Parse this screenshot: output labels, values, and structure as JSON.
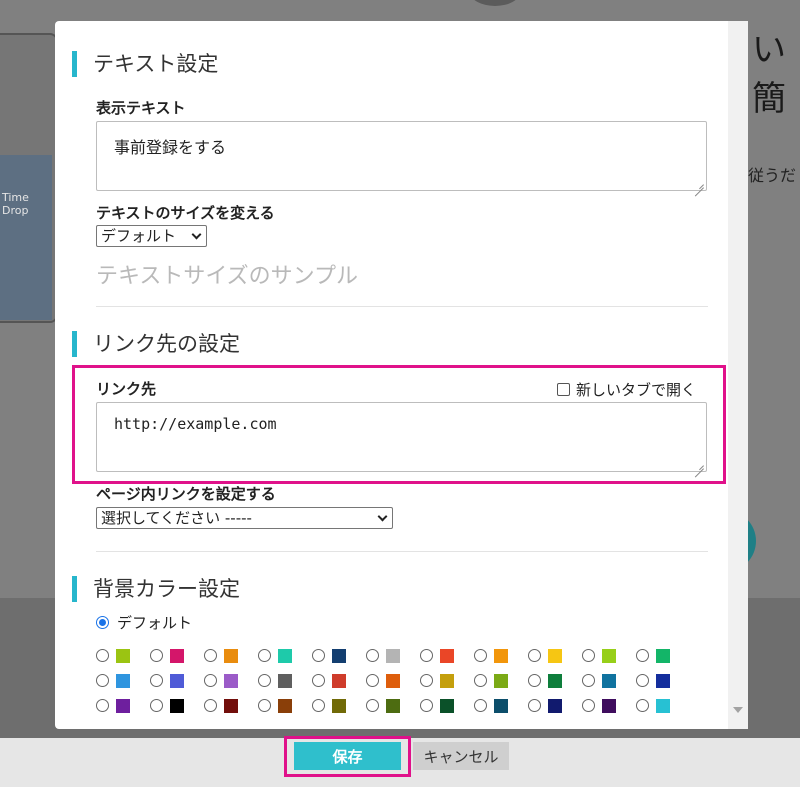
{
  "background": {
    "heading_fragment": "い簡",
    "text_fragment": "従うだ",
    "device_title": "Time Drop"
  },
  "modal": {
    "text_section": {
      "title": "テキスト設定",
      "display_text_label": "表示テキスト",
      "display_text_value": "事前登録をする",
      "size_label": "テキストのサイズを変える",
      "size_selected": "デフォルト",
      "size_sample": "テキストサイズのサンプル"
    },
    "link_section": {
      "title": "リンク先の設定",
      "link_label": "リンク先",
      "new_tab_label": "新しいタブで開く",
      "new_tab_checked": false,
      "link_value": "http://example.com",
      "anchor_label": "ページ内リンクを設定する",
      "anchor_selected": "選択してください -----"
    },
    "color_section": {
      "title": "背景カラー設定",
      "default_label": "デフォルト",
      "default_checked": true,
      "swatches": [
        [
          "#9bc412",
          "#d4166a",
          "#e98c0e",
          "#1ecaaa",
          "#133e70",
          "#b4b4b4",
          "#ea4627",
          "#f2960b",
          "#f6c613",
          "#97cf19",
          "#13b568"
        ],
        [
          "#2f95df",
          "#4f5bd7",
          "#9b5bc8",
          "#5f5f5f",
          "#cf3c2b",
          "#de5e0c",
          "#c49f0d",
          "#7baa16",
          "#0e7e3c",
          "#10739f",
          "#142e9d"
        ],
        [
          "#6e1f9e",
          "#000000",
          "#720e0b",
          "#8a3f09",
          "#716a07",
          "#4d6c11",
          "#0b5129",
          "#0c4e6b",
          "#111a6e",
          "#3f0d5e",
          "#27c1d3"
        ]
      ]
    }
  },
  "footer": {
    "save_label": "保存",
    "cancel_label": "キャンセル"
  }
}
